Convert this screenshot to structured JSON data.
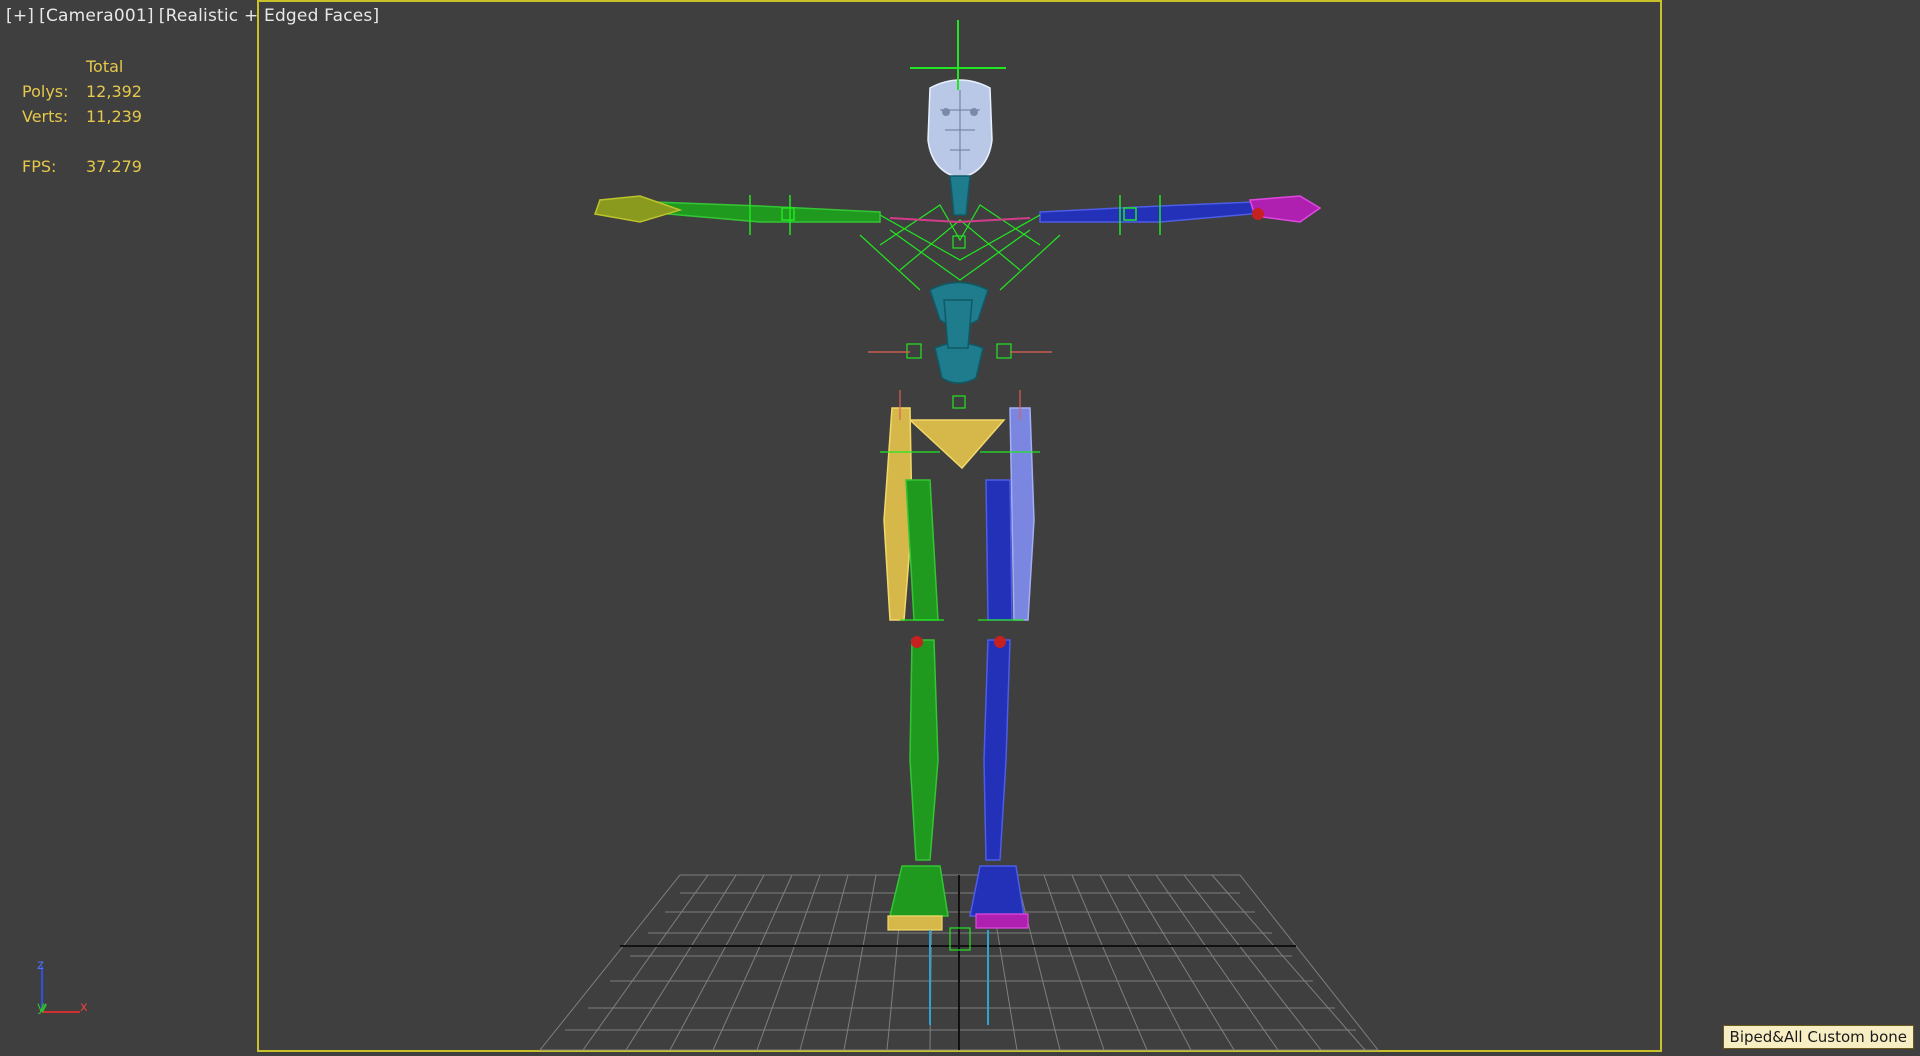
{
  "viewport": {
    "label_plus": "[+]",
    "label_camera": "[Camera001]",
    "label_shading": "[Realistic + Edged Faces]"
  },
  "stats": {
    "header": "Total",
    "polys_label": "Polys:",
    "polys_value": "12,392",
    "verts_label": "Verts:",
    "verts_value": "11,239",
    "fps_label": "FPS:",
    "fps_value": "37.279"
  },
  "gizmo": {
    "z": "z",
    "y": "y",
    "x": "x"
  },
  "status": {
    "badge": "Biped&All Custom bone"
  },
  "colors": {
    "background": "#3f3f3f",
    "stats_text": "#e6c84a",
    "safe_frame": "#c9c12a",
    "left_side": "#1f9a1f",
    "right_side": "#2330b8",
    "spine": "#1f7c8c",
    "pelvis": "#d6b84a",
    "helper_green": "#22e622",
    "head": "#b8c8e6",
    "grid": "#8a8a8a"
  }
}
